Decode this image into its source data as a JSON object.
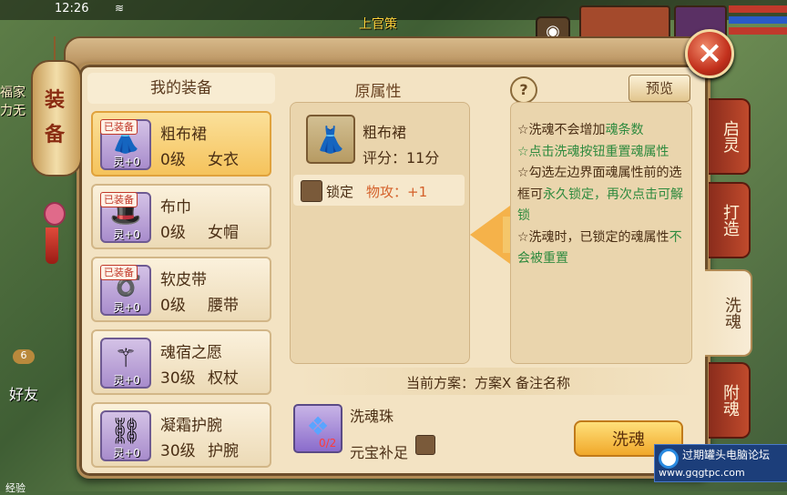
{
  "status_bar": {
    "time": "12:26",
    "npc_name": "上官策"
  },
  "side": {
    "left_text": "福家 力无",
    "friend_label": "好友",
    "friend_count": "6",
    "exp_label": "经验"
  },
  "panel": {
    "lantern_label": "装备",
    "close_symbol": "×"
  },
  "equipment_list": {
    "title": "我的装备",
    "items": [
      {
        "name": "粗布裙",
        "level": "0级",
        "type": "女衣",
        "equipped_tag": "已装备",
        "spirit": "灵+0",
        "icon": "robe-icon",
        "selected": true
      },
      {
        "name": "布巾",
        "level": "0级",
        "type": "女帽",
        "equipped_tag": "已装备",
        "spirit": "灵+0",
        "icon": "hat-icon",
        "selected": false
      },
      {
        "name": "软皮带",
        "level": "0级",
        "type": "腰带",
        "equipped_tag": "已装备",
        "spirit": "灵+0",
        "icon": "belt-icon",
        "selected": false
      },
      {
        "name": "魂宿之愿",
        "level": "30级",
        "type": "权杖",
        "equipped_tag": "",
        "spirit": "灵+0",
        "icon": "scepter-icon",
        "selected": false
      },
      {
        "name": "凝霜护腕",
        "level": "30级",
        "type": "护腕",
        "equipped_tag": "",
        "spirit": "灵+0",
        "icon": "bracer-icon",
        "selected": false
      }
    ]
  },
  "original_attributes": {
    "title": "原属性",
    "item_name": "粗布裙",
    "score": "评分：11分",
    "lock_label": "锁定",
    "attr": "物攻：+1"
  },
  "info": {
    "preview_label": "预览",
    "help_symbol": "?",
    "lines": [
      "☆洗魂不会增加",
      "魂条数",
      "☆点击洗魂按钮重置魂属性",
      "☆勾选左边界面魂属性前的选框可",
      "永久锁定，再次点击可解锁",
      "☆洗魂时，已锁定的魂属性",
      "不会被重置"
    ]
  },
  "bottom": {
    "plan": "当前方案：方案X  备注名称",
    "gem_name": "洗魂珠",
    "gem_count": "0/2",
    "yuanbao_label": "元宝补足",
    "wash_button": "洗魂"
  },
  "tabs": [
    "启灵",
    "打造",
    "洗魂",
    "附魂"
  ],
  "active_tab": "洗魂",
  "watermark": {
    "line1": "过期罐头电脑论坛",
    "line2": "www.gqgtpc.com"
  }
}
